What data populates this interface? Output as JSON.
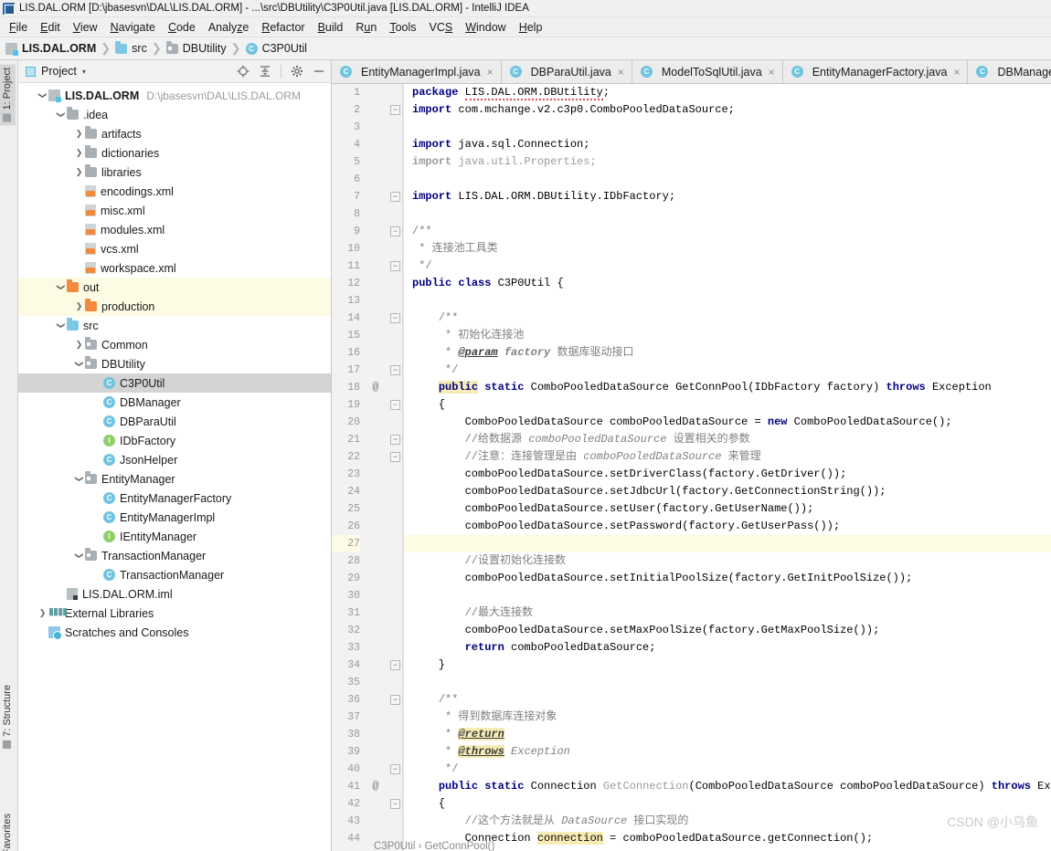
{
  "window": {
    "title": "LIS.DAL.ORM [D:\\jbasesvn\\DAL\\LIS.DAL.ORM] - ...\\src\\DBUtility\\C3P0Util.java [LIS.DAL.ORM] - IntelliJ IDEA",
    "app_icon": "intellij-idea-icon"
  },
  "menubar": {
    "items": [
      {
        "label": "File",
        "mnemonic": "F"
      },
      {
        "label": "Edit",
        "mnemonic": "E"
      },
      {
        "label": "View",
        "mnemonic": "V"
      },
      {
        "label": "Navigate",
        "mnemonic": "N"
      },
      {
        "label": "Code",
        "mnemonic": "C"
      },
      {
        "label": "Analyze",
        "mnemonic": "z"
      },
      {
        "label": "Refactor",
        "mnemonic": "R"
      },
      {
        "label": "Build",
        "mnemonic": "B"
      },
      {
        "label": "Run",
        "mnemonic": "u"
      },
      {
        "label": "Tools",
        "mnemonic": "T"
      },
      {
        "label": "VCS",
        "mnemonic": "S"
      },
      {
        "label": "Window",
        "mnemonic": "W"
      },
      {
        "label": "Help",
        "mnemonic": "H"
      }
    ]
  },
  "breadcrumb": {
    "items": [
      {
        "label": "LIS.DAL.ORM",
        "icon": "module-icon",
        "bold": true
      },
      {
        "label": "src",
        "icon": "source-folder-icon",
        "bold": false
      },
      {
        "label": "DBUtility",
        "icon": "package-folder-icon",
        "bold": false
      },
      {
        "label": "C3P0Util",
        "icon": "class-icon",
        "bold": false
      }
    ],
    "separator": "❯"
  },
  "left_strip": {
    "tabs": [
      {
        "label": "1: Project",
        "selected": true
      },
      {
        "label": "7: Structure",
        "selected": false
      },
      {
        "label": "Favorites",
        "selected": false
      }
    ]
  },
  "project_panel": {
    "title": "Project",
    "caret": "▾",
    "tools": [
      {
        "name": "locate-target-icon"
      },
      {
        "name": "collapse-all-icon"
      },
      {
        "name": "settings-gear-icon"
      },
      {
        "name": "hide-panel-icon"
      }
    ],
    "tree": [
      {
        "indent": 0,
        "arrow": "down",
        "icon": "module-icon",
        "label": "LIS.DAL.ORM",
        "sub": "D:\\jbasesvn\\DAL\\LIS.DAL.ORM",
        "bold": true,
        "state": "normal"
      },
      {
        "indent": 1,
        "arrow": "down",
        "icon": "folder-icon-gray",
        "label": ".idea",
        "sub": "",
        "bold": false,
        "state": "normal"
      },
      {
        "indent": 2,
        "arrow": "right",
        "icon": "folder-icon-gray",
        "label": "artifacts",
        "sub": "",
        "bold": false,
        "state": "normal"
      },
      {
        "indent": 2,
        "arrow": "right",
        "icon": "folder-icon-gray",
        "label": "dictionaries",
        "sub": "",
        "bold": false,
        "state": "normal"
      },
      {
        "indent": 2,
        "arrow": "right",
        "icon": "folder-icon-gray",
        "label": "libraries",
        "sub": "",
        "bold": false,
        "state": "normal"
      },
      {
        "indent": 2,
        "arrow": "none",
        "icon": "xml-file-icon",
        "label": "encodings.xml",
        "sub": "",
        "bold": false,
        "state": "normal"
      },
      {
        "indent": 2,
        "arrow": "none",
        "icon": "xml-file-icon",
        "label": "misc.xml",
        "sub": "",
        "bold": false,
        "state": "normal"
      },
      {
        "indent": 2,
        "arrow": "none",
        "icon": "xml-file-icon",
        "label": "modules.xml",
        "sub": "",
        "bold": false,
        "state": "normal"
      },
      {
        "indent": 2,
        "arrow": "none",
        "icon": "xml-file-icon",
        "label": "vcs.xml",
        "sub": "",
        "bold": false,
        "state": "normal"
      },
      {
        "indent": 2,
        "arrow": "none",
        "icon": "xml-file-icon",
        "label": "workspace.xml",
        "sub": "",
        "bold": false,
        "state": "normal"
      },
      {
        "indent": 1,
        "arrow": "down",
        "icon": "folder-icon-orange",
        "label": "out",
        "sub": "",
        "bold": false,
        "state": "excluded"
      },
      {
        "indent": 2,
        "arrow": "right",
        "icon": "folder-icon-orange",
        "label": "production",
        "sub": "",
        "bold": false,
        "state": "excluded"
      },
      {
        "indent": 1,
        "arrow": "down",
        "icon": "folder-icon-blue",
        "label": "src",
        "sub": "",
        "bold": false,
        "state": "normal"
      },
      {
        "indent": 2,
        "arrow": "right",
        "icon": "package-folder-icon",
        "label": "Common",
        "sub": "",
        "bold": false,
        "state": "normal"
      },
      {
        "indent": 2,
        "arrow": "down",
        "icon": "package-folder-icon",
        "label": "DBUtility",
        "sub": "",
        "bold": false,
        "state": "normal"
      },
      {
        "indent": 3,
        "arrow": "none",
        "icon": "class-icon",
        "label": "C3P0Util",
        "sub": "",
        "bold": false,
        "state": "selected"
      },
      {
        "indent": 3,
        "arrow": "none",
        "icon": "class-icon",
        "label": "DBManager",
        "sub": "",
        "bold": false,
        "state": "normal"
      },
      {
        "indent": 3,
        "arrow": "none",
        "icon": "class-icon",
        "label": "DBParaUtil",
        "sub": "",
        "bold": false,
        "state": "normal"
      },
      {
        "indent": 3,
        "arrow": "none",
        "icon": "interface-icon",
        "label": "IDbFactory",
        "sub": "",
        "bold": false,
        "state": "normal"
      },
      {
        "indent": 3,
        "arrow": "none",
        "icon": "class-icon",
        "label": "JsonHelper",
        "sub": "",
        "bold": false,
        "state": "normal"
      },
      {
        "indent": 2,
        "arrow": "down",
        "icon": "package-folder-icon",
        "label": "EntityManager",
        "sub": "",
        "bold": false,
        "state": "normal"
      },
      {
        "indent": 3,
        "arrow": "none",
        "icon": "class-icon",
        "label": "EntityManagerFactory",
        "sub": "",
        "bold": false,
        "state": "normal"
      },
      {
        "indent": 3,
        "arrow": "none",
        "icon": "class-icon",
        "label": "EntityManagerImpl",
        "sub": "",
        "bold": false,
        "state": "normal"
      },
      {
        "indent": 3,
        "arrow": "none",
        "icon": "interface-icon",
        "label": "IEntityManager",
        "sub": "",
        "bold": false,
        "state": "normal"
      },
      {
        "indent": 2,
        "arrow": "down",
        "icon": "package-folder-icon",
        "label": "TransactionManager",
        "sub": "",
        "bold": false,
        "state": "normal"
      },
      {
        "indent": 3,
        "arrow": "none",
        "icon": "class-icon",
        "label": "TransactionManager",
        "sub": "",
        "bold": false,
        "state": "normal"
      },
      {
        "indent": 1,
        "arrow": "none",
        "icon": "iml-file-icon",
        "label": "LIS.DAL.ORM.iml",
        "sub": "",
        "bold": false,
        "state": "normal"
      },
      {
        "indent": 0,
        "arrow": "right",
        "icon": "library-icon",
        "label": "External Libraries",
        "sub": "",
        "bold": false,
        "state": "normal"
      },
      {
        "indent": 0,
        "arrow": "none",
        "icon": "scratch-icon",
        "label": "Scratches and Consoles",
        "sub": "",
        "bold": false,
        "state": "normal"
      }
    ]
  },
  "editor_tabs": {
    "close_glyph": "×",
    "items": [
      {
        "label": "EntityManagerImpl.java",
        "icon": "class-icon",
        "active": false,
        "closable": true
      },
      {
        "label": "DBParaUtil.java",
        "icon": "class-icon",
        "active": false,
        "closable": true
      },
      {
        "label": "ModelToSqlUtil.java",
        "icon": "class-icon",
        "active": false,
        "closable": true
      },
      {
        "label": "EntityManagerFactory.java",
        "icon": "class-icon",
        "active": false,
        "closable": true
      },
      {
        "label": "DBManager.j",
        "icon": "class-icon",
        "active": false,
        "closable": false
      }
    ]
  },
  "editor": {
    "bottom_breadcrumb": "C3P0Util  ›  GetConnPool()",
    "watermark": "CSDN @小乌鱼",
    "current_line": 27,
    "annotations": [
      {
        "line": 18,
        "glyph": "@"
      },
      {
        "line": 41,
        "glyph": "@"
      }
    ],
    "folds": [
      {
        "line": 2,
        "type": "collapse-marker"
      },
      {
        "line": 7,
        "type": "collapse-marker"
      },
      {
        "line": 9,
        "type": "region-start"
      },
      {
        "line": 11,
        "type": "region-end"
      },
      {
        "line": 14,
        "type": "region-start"
      },
      {
        "line": 17,
        "type": "region-end"
      },
      {
        "line": 19,
        "type": "region-start"
      },
      {
        "line": 21,
        "type": "region-mid"
      },
      {
        "line": 22,
        "type": "region-end"
      },
      {
        "line": 34,
        "type": "region-end"
      },
      {
        "line": 36,
        "type": "region-start"
      },
      {
        "line": 40,
        "type": "region-end"
      },
      {
        "line": 42,
        "type": "region-start"
      }
    ],
    "lines": [
      {
        "n": 1,
        "text": "package LIS.DAL.ORM.DBUtility;"
      },
      {
        "n": 2,
        "text": "import com.mchange.v2.c3p0.ComboPooledDataSource;"
      },
      {
        "n": 3,
        "text": ""
      },
      {
        "n": 4,
        "text": "import java.sql.Connection;"
      },
      {
        "n": 5,
        "text": "import java.util.Properties;"
      },
      {
        "n": 6,
        "text": ""
      },
      {
        "n": 7,
        "text": "import LIS.DAL.ORM.DBUtility.IDbFactory;"
      },
      {
        "n": 8,
        "text": ""
      },
      {
        "n": 9,
        "text": "/**"
      },
      {
        "n": 10,
        "text": " * 连接池工具类"
      },
      {
        "n": 11,
        "text": " */"
      },
      {
        "n": 12,
        "text": "public class C3P0Util {"
      },
      {
        "n": 13,
        "text": ""
      },
      {
        "n": 14,
        "text": "    /**"
      },
      {
        "n": 15,
        "text": "     * 初始化连接池"
      },
      {
        "n": 16,
        "text": "     * @param factory 数据库驱动接口"
      },
      {
        "n": 17,
        "text": "     */"
      },
      {
        "n": 18,
        "text": "    public static ComboPooledDataSource GetConnPool(IDbFactory factory) throws Exception"
      },
      {
        "n": 19,
        "text": "    {"
      },
      {
        "n": 20,
        "text": "        ComboPooledDataSource comboPooledDataSource = new ComboPooledDataSource();"
      },
      {
        "n": 21,
        "text": "        //给数据源 comboPooledDataSource 设置相关的参数"
      },
      {
        "n": 22,
        "text": "        //注意：连接管理是由 comboPooledDataSource 来管理"
      },
      {
        "n": 23,
        "text": "        comboPooledDataSource.setDriverClass(factory.GetDriver());"
      },
      {
        "n": 24,
        "text": "        comboPooledDataSource.setJdbcUrl(factory.GetConnectionString());"
      },
      {
        "n": 25,
        "text": "        comboPooledDataSource.setUser(factory.GetUserName());"
      },
      {
        "n": 26,
        "text": "        comboPooledDataSource.setPassword(factory.GetUserPass());"
      },
      {
        "n": 27,
        "text": ""
      },
      {
        "n": 28,
        "text": "        //设置初始化连接数"
      },
      {
        "n": 29,
        "text": "        comboPooledDataSource.setInitialPoolSize(factory.GetInitPoolSize());"
      },
      {
        "n": 30,
        "text": ""
      },
      {
        "n": 31,
        "text": "        //最大连接数"
      },
      {
        "n": 32,
        "text": "        comboPooledDataSource.setMaxPoolSize(factory.GetMaxPoolSize());"
      },
      {
        "n": 33,
        "text": "        return comboPooledDataSource;"
      },
      {
        "n": 34,
        "text": "    }"
      },
      {
        "n": 35,
        "text": ""
      },
      {
        "n": 36,
        "text": "    /**"
      },
      {
        "n": 37,
        "text": "     * 得到数据库连接对象"
      },
      {
        "n": 38,
        "text": "     * @return"
      },
      {
        "n": 39,
        "text": "     * @throws Exception"
      },
      {
        "n": 40,
        "text": "     */"
      },
      {
        "n": 41,
        "text": "    public static Connection GetConnection(ComboPooledDataSource comboPooledDataSource) throws Exception"
      },
      {
        "n": 42,
        "text": "    {"
      },
      {
        "n": 43,
        "text": "        //这个方法就是从 DataSource 接口实现的"
      },
      {
        "n": 44,
        "text": "        Connection connection = comboPooledDataSource.getConnection();"
      }
    ]
  },
  "colors": {
    "keyword": "#000080",
    "comment": "#808080",
    "grayed_code": "#9a9a9a",
    "current_line_bg": "#fdfbe4",
    "selection_bg": "#d4d4d4",
    "excluded_folder": "#f2893c",
    "source_folder": "#7ec8e3",
    "class_icon": "#6fc4e0",
    "interface_icon": "#8fce6a",
    "highlight_bg": "#f7ecb5"
  }
}
